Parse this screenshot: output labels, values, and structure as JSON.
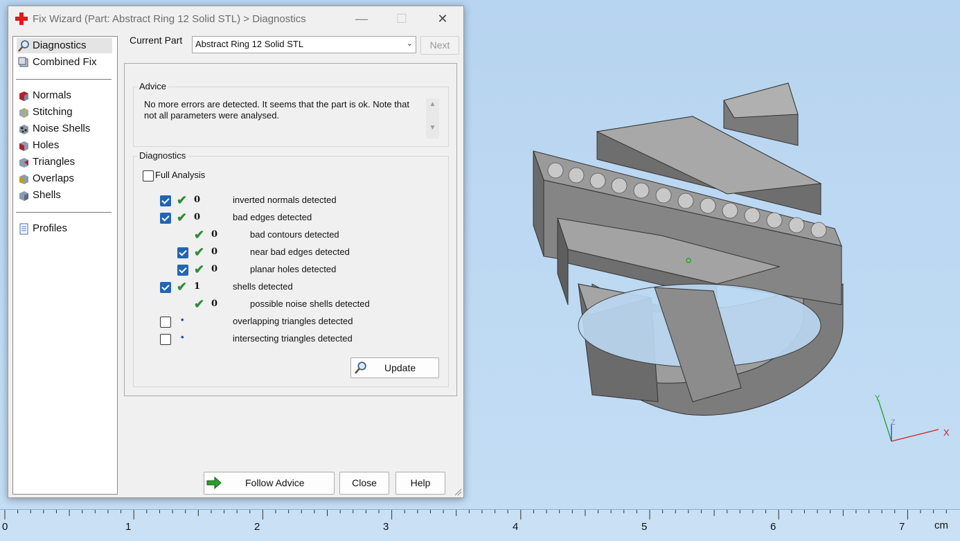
{
  "window": {
    "title": "Fix Wizard (Part: Abstract Ring 12 Solid STL) > Diagnostics",
    "controls": {
      "minimize": "—",
      "maximize": "☐",
      "close": "✕"
    }
  },
  "sidebar": {
    "items": [
      {
        "label": "Diagnostics",
        "icon": "magnifier-icon"
      },
      {
        "label": "Combined Fix",
        "icon": "combined-fix-icon"
      },
      {
        "label": "Normals",
        "icon": "normals-cube-icon"
      },
      {
        "label": "Stitching",
        "icon": "stitching-cube-icon"
      },
      {
        "label": "Noise Shells",
        "icon": "noise-shells-icon"
      },
      {
        "label": "Holes",
        "icon": "holes-cube-icon"
      },
      {
        "label": "Triangles",
        "icon": "triangles-cube-icon"
      },
      {
        "label": "Overlaps",
        "icon": "overlaps-cube-icon"
      },
      {
        "label": "Shells",
        "icon": "shells-cube-icon"
      },
      {
        "label": "Profiles",
        "icon": "profiles-document-icon"
      }
    ]
  },
  "part": {
    "label": "Current Part",
    "value": "Abstract Ring 12 Solid STL",
    "next_label": "Next"
  },
  "advice": {
    "title": "Advice",
    "text": "No more errors are detected. It seems that the part is ok. Note that not all parameters were analysed."
  },
  "diagnostics": {
    "title": "Diagnostics",
    "full_analysis_label": "Full Analysis",
    "rows": [
      {
        "count": "0",
        "label": "inverted normals detected"
      },
      {
        "count": "0",
        "label": "bad edges detected"
      },
      {
        "count": "0",
        "label": "bad contours detected"
      },
      {
        "count": "0",
        "label": "near bad edges detected"
      },
      {
        "count": "0",
        "label": "planar holes detected"
      },
      {
        "count": "1",
        "label": "shells detected"
      },
      {
        "count": "0",
        "label": "possible noise shells detected"
      },
      {
        "count": "",
        "label": "overlapping triangles detected"
      },
      {
        "count": "",
        "label": "intersecting triangles detected"
      }
    ],
    "update_label": "Update"
  },
  "footer": {
    "follow_advice_label": "Follow Advice",
    "close_label": "Close",
    "help_label": "Help"
  },
  "axes": {
    "x": "X",
    "y": "Y",
    "z": "Z"
  },
  "ruler": {
    "labels": [
      "0",
      "1",
      "2",
      "3",
      "4",
      "5",
      "6",
      "7"
    ],
    "unit": "cm"
  },
  "colors": {
    "viewport_bg": "#bcd9f4",
    "checkbox_on": "#2166b3",
    "ok_tick": "#2f8c3a",
    "axis_x": "#d22020",
    "axis_y": "#20a020"
  }
}
